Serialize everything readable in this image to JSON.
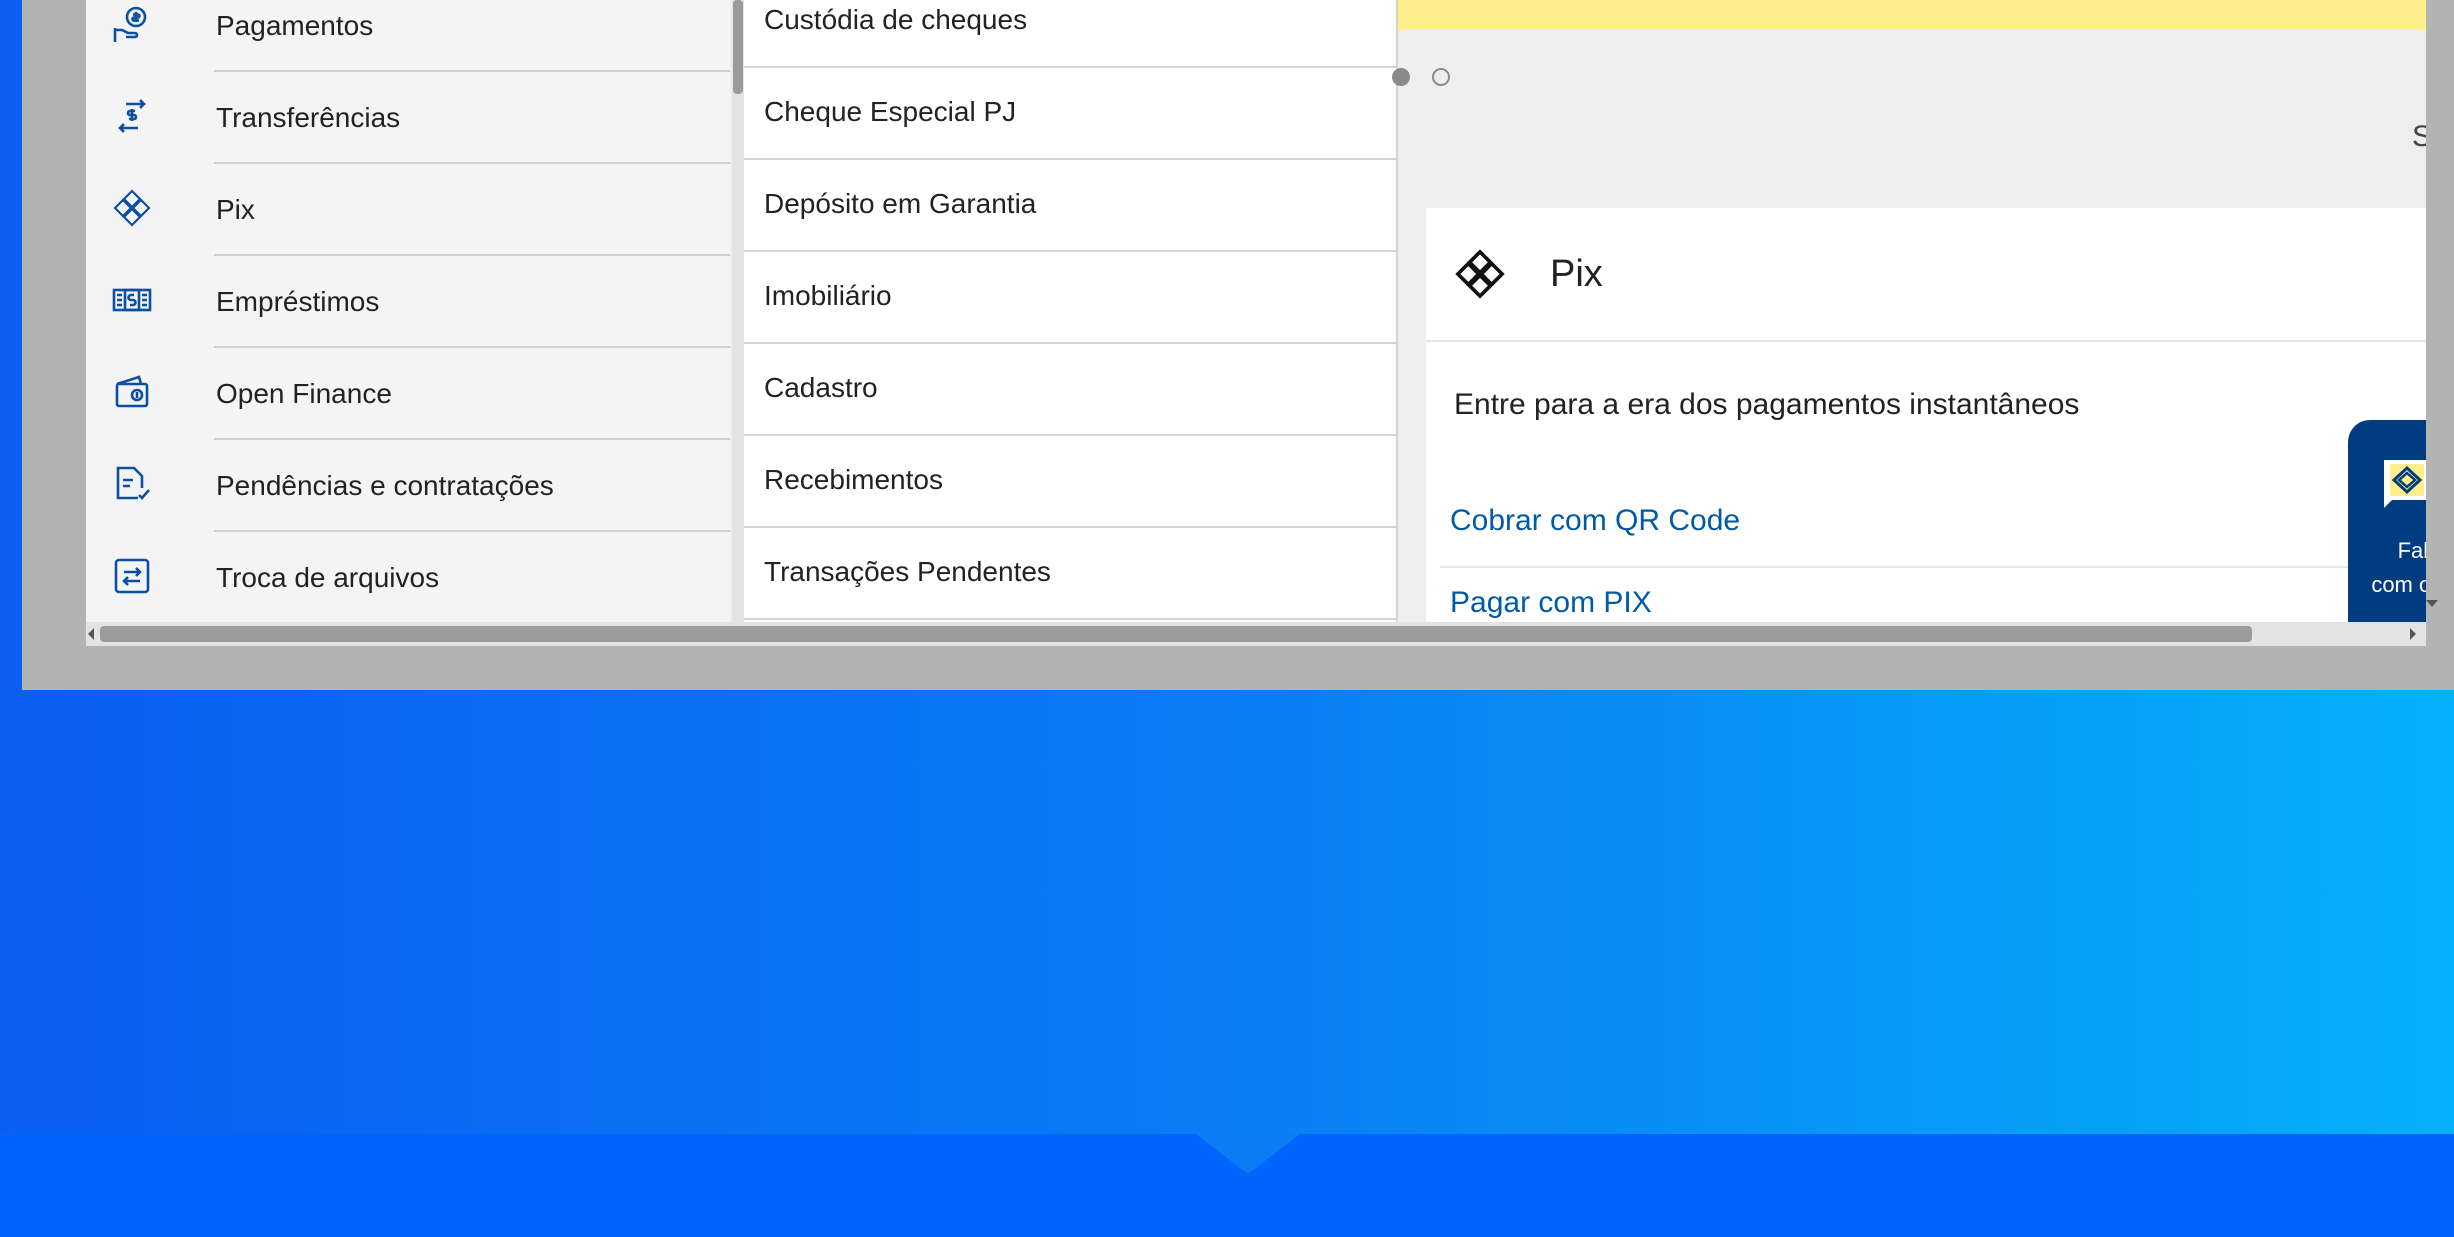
{
  "menu1": {
    "items": [
      {
        "label": "Pagamentos",
        "icon": "money-hand-icon"
      },
      {
        "label": "Transferências",
        "icon": "transfer-arrows-icon"
      },
      {
        "label": "Pix",
        "icon": "pix-icon"
      },
      {
        "label": "Empréstimos",
        "icon": "banknotes-icon"
      },
      {
        "label": "Open Finance",
        "icon": "wallet-icon"
      },
      {
        "label": "Pendências e contratações",
        "icon": "document-check-icon"
      },
      {
        "label": "Troca de arquivos",
        "icon": "file-exchange-icon"
      }
    ]
  },
  "menu2": {
    "items": [
      {
        "label": "Custódia de cheques"
      },
      {
        "label": "Cheque Especial PJ"
      },
      {
        "label": "Depósito em Garantia"
      },
      {
        "label": "Imobiliário"
      },
      {
        "label": "Cadastro"
      },
      {
        "label": "Recebimentos"
      },
      {
        "label": "Transações Pendentes"
      }
    ]
  },
  "main": {
    "s_letter": "S",
    "pix_card": {
      "title": "Pix",
      "subtitle": "Entre para a era dos pagamentos instantâneos",
      "links": [
        "Cobrar com QR Code",
        "Pagar com PIX"
      ]
    }
  },
  "fale": {
    "line1": "Fale",
    "line2": "com o BB"
  },
  "colors": {
    "primary_blue": "#003c7f",
    "link_blue": "#005aa5",
    "banner_yellow": "#fdf08c",
    "background_blue": "#0a7df4"
  }
}
